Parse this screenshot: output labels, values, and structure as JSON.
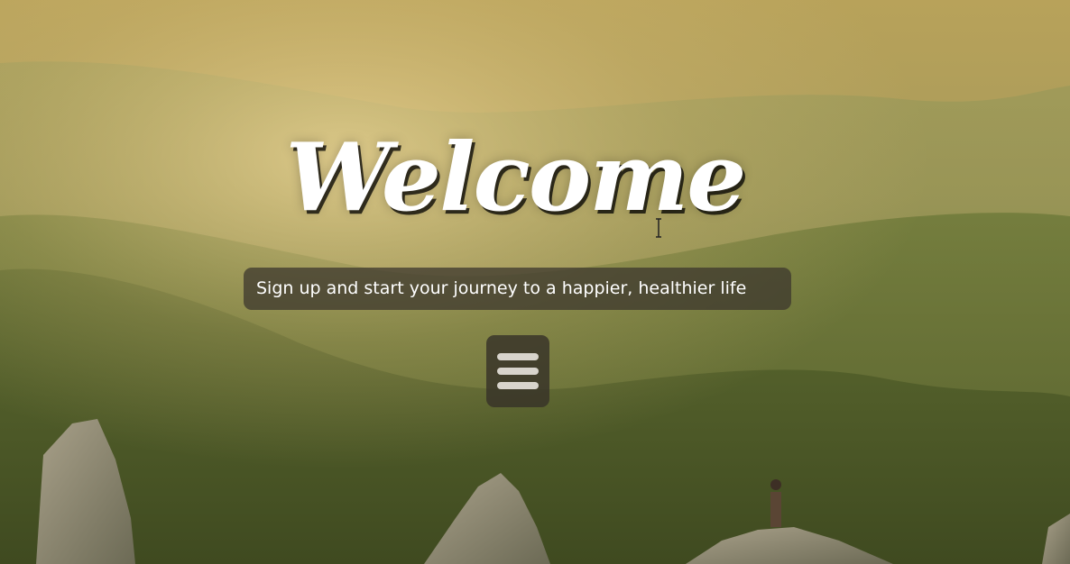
{
  "hero": {
    "title": "Welcome",
    "tagline": "Sign up and start your journey to a happier, healthier life"
  },
  "menu": {
    "icon": "hamburger-menu-icon"
  },
  "colors": {
    "title_text": "#ffffff",
    "tagline_bg": "#3c372d",
    "menu_bg": "#373228",
    "menu_bars": "#d8d4cc"
  }
}
